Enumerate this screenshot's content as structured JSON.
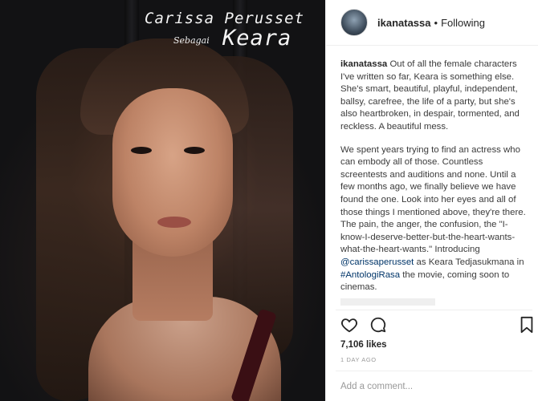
{
  "photo": {
    "caption_name": "Carissa Perusset",
    "caption_as": "Sebagai",
    "caption_role": "Keara"
  },
  "header": {
    "username": "ikanatassa",
    "separator": "•",
    "follow_status": "Following"
  },
  "caption": {
    "username": "ikanatassa",
    "paragraph1": "Out of all the female characters I've written so far, Keara is something else. She's smart, beautiful, playful, independent, ballsy, carefree, the life of a party, but she's also heartbroken, in despair, tormented, and reckless. A beautiful mess.",
    "paragraph2_text": "We spent years trying to find an actress who can embody all of those. Countless screentests and auditions and none. Until a few months ago, we finally believe we have found the one. Look into her eyes and all of those things I mentioned above, they're there. The pain, the anger, the confusion, the \"I-know-I-deserve-better-but-the-heart-wants-what-the-heart-wants.\" Introducing",
    "mention": "@carissaperusset",
    "mid_text": "as Keara Tedjasukmana in",
    "hashtag": "#AntologiRasa",
    "end_text": "the movie, coming soon to cinemas."
  },
  "actions": {
    "like_icon": "heart-icon",
    "comment_icon": "comment-icon",
    "save_icon": "bookmark-icon"
  },
  "likes": "7,106 likes",
  "timestamp": "1 DAY AGO",
  "comment_placeholder": "Add a comment..."
}
